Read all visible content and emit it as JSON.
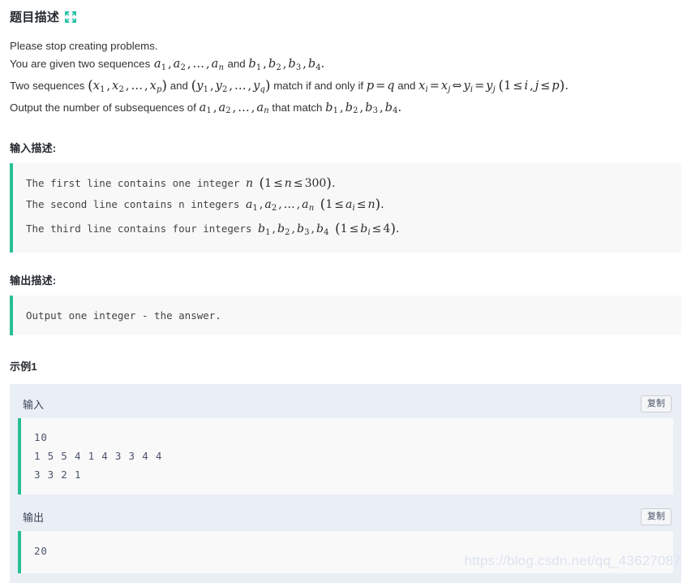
{
  "title": {
    "text": "题目描述",
    "icon": "expand-arrows-icon",
    "icon_color": "#1fbfa0"
  },
  "statement": {
    "lines": [
      "Please stop creating problems.",
      "You are given two sequences a1, a2, ..., an and b1, b2, b3, b4.",
      "Two sequences (x1, x2, ..., xp) and (y1, y2, ..., yq) match if and only if p = q and xi = xj ⇔ yi = yj (1 ≤ i, j ≤ p).",
      "Output the number of subsequences of a1, a2, ..., an that match b1, b2, b3, b4."
    ],
    "line1_plain": "Please stop creating problems.",
    "line2_prefix": "You are given two sequences",
    "line2_mid": "and",
    "line3_prefix": "Two sequences",
    "line3_and": "and",
    "line3_match": "match if and only if",
    "line3_and2": "and",
    "line4_prefix": "Output the number of subsequences of",
    "line4_mid": "that match"
  },
  "input_section": {
    "heading": "输入描述:",
    "lines": [
      "The first line contains one integer n (1 ≤ n ≤ 300).",
      "The second line contains n integers a1,a2,...,an (1 ≤ ai ≤ n).",
      "The third line contains four integers b1,b2,b3,b4 (1 ≤ bi ≤ 4)."
    ],
    "line1_text": "The first line contains one integer",
    "line2_text": "The second line contains n integers",
    "line3_text": "The third line contains four integers"
  },
  "output_section": {
    "heading": "输出描述:",
    "text": "Output one integer - the answer."
  },
  "example": {
    "heading": "示例1",
    "input_label": "输入",
    "output_label": "输出",
    "copy_label": "复制",
    "input_lines": [
      "10",
      "1 5 5 4 1 4 3 3 4 4",
      "3 3 2 1"
    ],
    "output_lines": [
      "20"
    ]
  },
  "watermark": {
    "text": "https://blog.csdn.net/qq_43627087"
  },
  "colors": {
    "accent_teal": "#27c093",
    "heading": "#24292e",
    "panel_bg": "#eaeef5",
    "code_bg": "#f8f8f9"
  }
}
